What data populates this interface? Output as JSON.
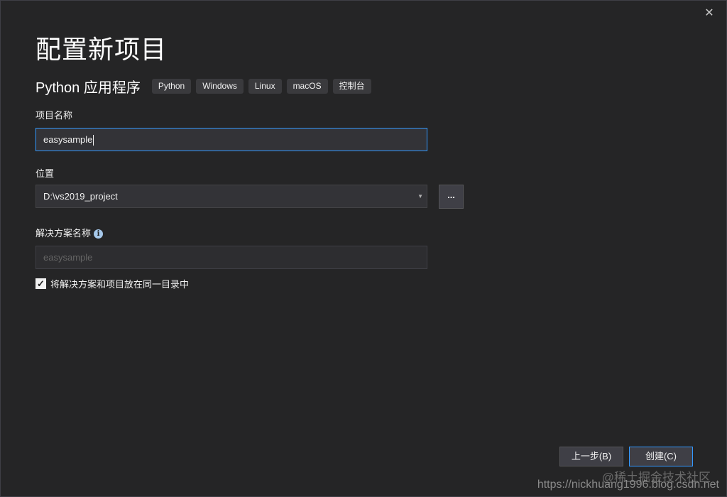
{
  "dialog": {
    "title": "配置新项目",
    "close_label": "✕"
  },
  "template": {
    "name": "Python 应用程序",
    "tags": [
      "Python",
      "Windows",
      "Linux",
      "macOS",
      "控制台"
    ]
  },
  "project_name": {
    "label": "项目名称",
    "value": "easysample"
  },
  "location": {
    "label": "位置",
    "value": "D:\\vs2019_project",
    "dropdown_arrow": "▼",
    "browse_label": "..."
  },
  "solution_name": {
    "label": "解决方案名称",
    "info_icon": "i",
    "placeholder": "easysample"
  },
  "same_directory": {
    "checked": true,
    "check_glyph": "✓",
    "label": "将解决方案和项目放在同一目录中"
  },
  "buttons": {
    "back": "上一步(B)",
    "create": "创建(C)"
  },
  "watermark": {
    "line1": "@稀土掘金技术社区",
    "line2": "https://nickhuang1996.blog.csdn.net"
  }
}
